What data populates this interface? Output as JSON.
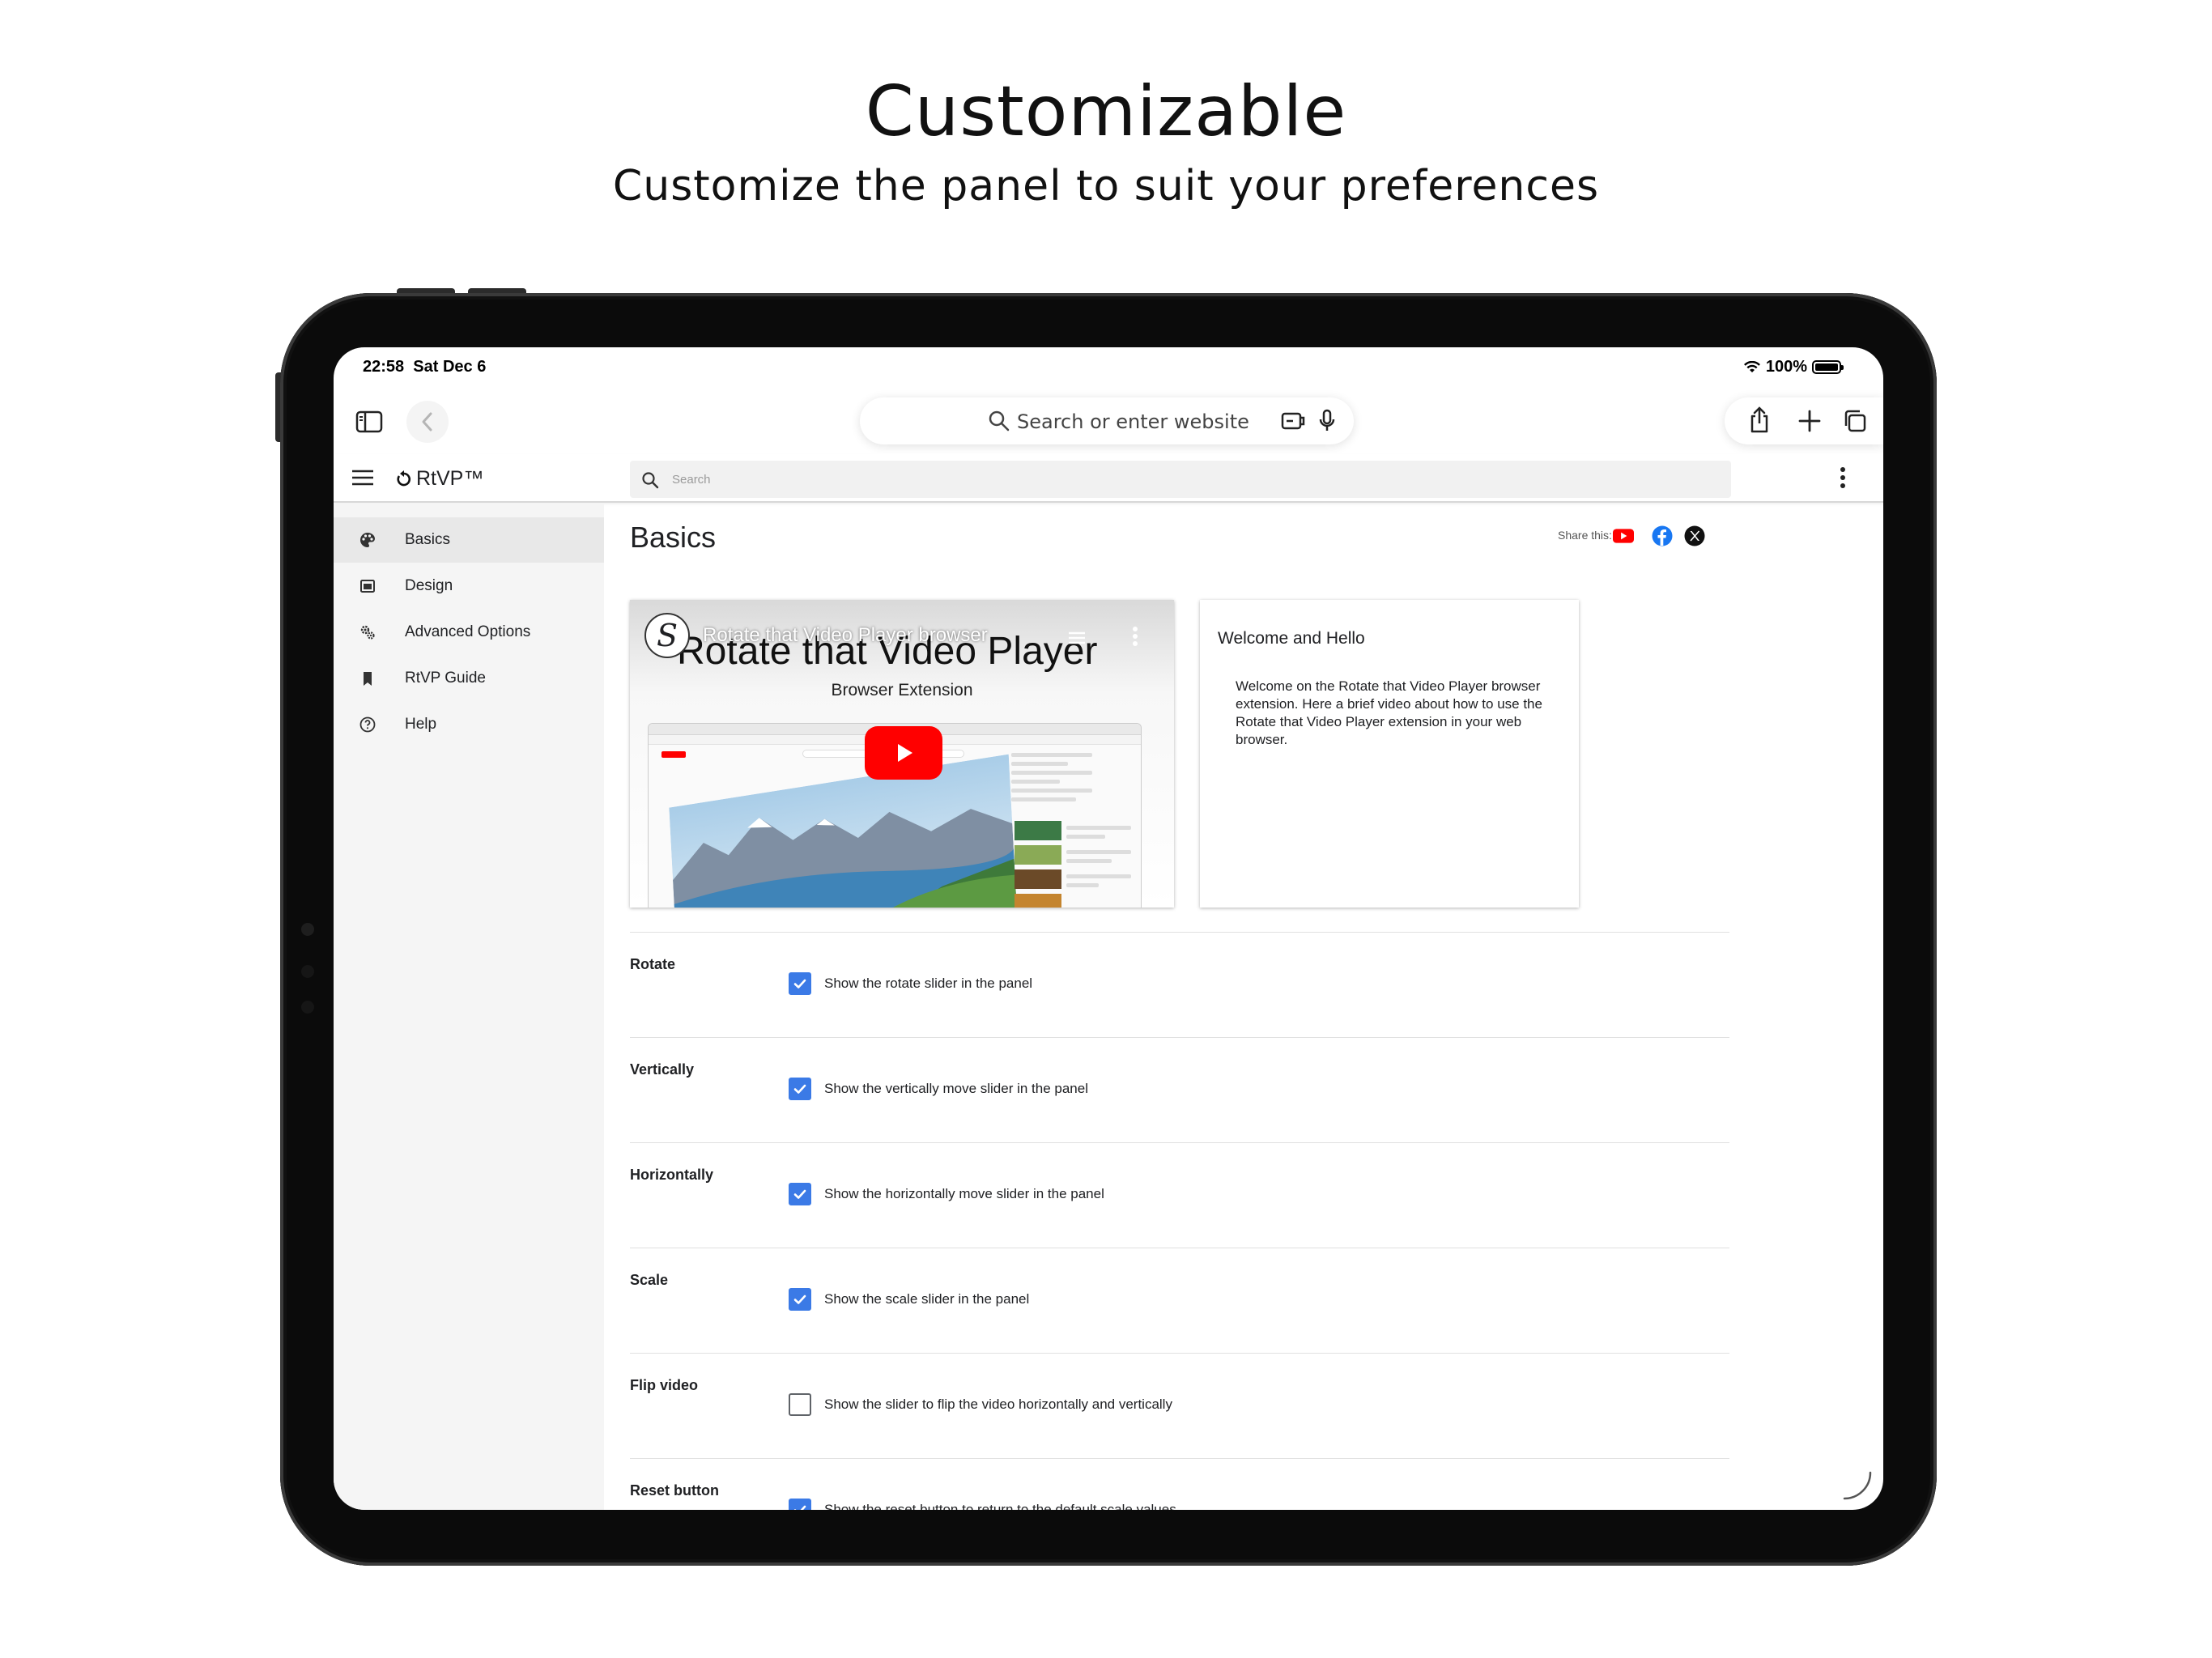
{
  "hero": {
    "title": "Customizable",
    "subtitle": "Customize the panel to suit your preferences"
  },
  "status_bar": {
    "time": "22:58",
    "date": "Sat Dec 6",
    "battery": "100%",
    "battery_level": 1.0
  },
  "safari": {
    "url_placeholder": "Search or enter website",
    "icons": [
      "sidebar-icon",
      "back-icon",
      "search-icon",
      "extension-icon",
      "microphone-icon",
      "share-icon",
      "plus-icon",
      "tabs-icon"
    ]
  },
  "app": {
    "brand": "RtVP™",
    "search_placeholder": "Search"
  },
  "sidebar": {
    "items": [
      {
        "label": "Basics",
        "icon": "palette-icon",
        "active": true
      },
      {
        "label": "Design",
        "icon": "window-icon",
        "active": false
      },
      {
        "label": "Advanced Options",
        "icon": "settings-gear-icon",
        "active": false
      },
      {
        "label": "RtVP Guide",
        "icon": "bookmark-icon",
        "active": false
      },
      {
        "label": "Help",
        "icon": "help-icon",
        "active": false
      }
    ]
  },
  "main": {
    "title": "Basics",
    "share_label": "Share this:",
    "share_icons": [
      "youtube-icon",
      "facebook-icon",
      "x-icon"
    ],
    "video": {
      "overlay_title": "Rotate that Video Player browser",
      "big_title": "Rotate that Video Player",
      "sub_title": "Browser Extension",
      "logo_letter": "S"
    },
    "welcome": {
      "title": "Welcome and Hello",
      "body": "Welcome on the Rotate that Video Player browser extension. Here a brief video about how to use the Rotate that Video Player extension in your web browser."
    },
    "options": [
      {
        "label": "Rotate",
        "text": "Show the rotate slider in the panel",
        "checked": true
      },
      {
        "label": "Vertically",
        "text": "Show the vertically move slider in the panel",
        "checked": true
      },
      {
        "label": "Horizontally",
        "text": "Show the horizontally move slider in the panel",
        "checked": true
      },
      {
        "label": "Scale",
        "text": "Show the scale slider in the panel",
        "checked": true
      },
      {
        "label": "Flip video",
        "text": "Show the slider to flip the video horizontally and vertically",
        "checked": false
      },
      {
        "label": "Reset button",
        "text": "Show the reset button to return to the default scale values",
        "checked": true
      }
    ]
  },
  "colors": {
    "accent": "#3b7ae6",
    "youtube": "#ff0000",
    "facebook": "#1877f2"
  }
}
